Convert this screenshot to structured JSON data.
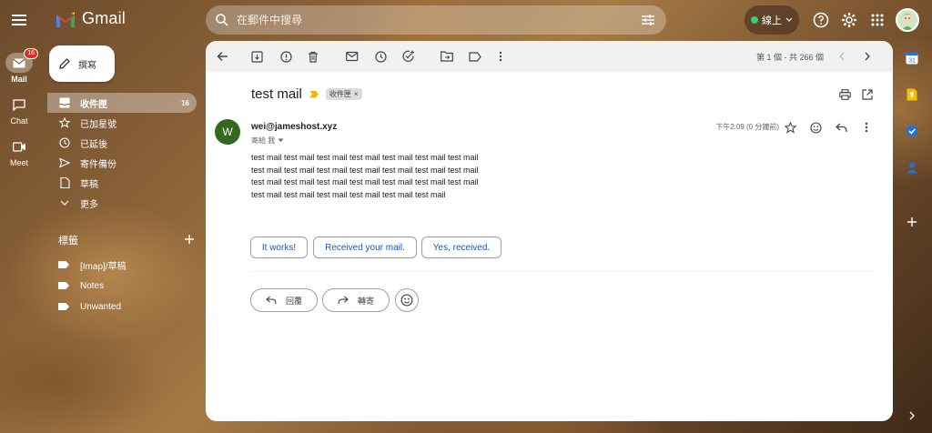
{
  "app": {
    "name": "Gmail"
  },
  "search": {
    "placeholder": "在郵件中搜尋"
  },
  "status": {
    "label": "線上"
  },
  "rail": {
    "mail_label": "Mail",
    "mail_badge": "16",
    "chat_label": "Chat",
    "meet_label": "Meet"
  },
  "compose": {
    "label": "撰寫"
  },
  "nav": {
    "items": [
      {
        "label": "收件匣",
        "count": "16"
      },
      {
        "label": "已加星號"
      },
      {
        "label": "已延後"
      },
      {
        "label": "寄件備份"
      },
      {
        "label": "草稿"
      },
      {
        "label": "更多"
      }
    ]
  },
  "labels": {
    "heading": "標籤",
    "items": [
      "[Imap]/草稿",
      "Notes",
      "Unwanted"
    ]
  },
  "toolbar": {
    "pager": "第 1 個 - 共 266 個"
  },
  "message": {
    "subject": "test mail",
    "chip": "收件匣",
    "chip_close": "×",
    "avatar_letter": "W",
    "sender": "wei@jameshost.xyz",
    "to": "寄給 我",
    "timestamp": "下午2:09 (0 分鐘前)",
    "body_lines": [
      "test mail test mail test mail test mail test mail test mail test mail",
      "test mail test mail test mail test mail test mail test mail test mail",
      "test mail test mail test mail test mail test mail test mail test mail",
      "test mail test mail test mail test mail test mail test mail"
    ]
  },
  "smart_replies": [
    "It works!",
    "Received your mail.",
    "Yes, received."
  ],
  "actions": {
    "reply": "回覆",
    "forward": "轉寄"
  },
  "colors": {
    "avatar": "#33691e",
    "badge": "#d93025",
    "status_dot": "#34d36b",
    "smart_reply_text": "#1a57c0",
    "importance": "#f4b400"
  }
}
